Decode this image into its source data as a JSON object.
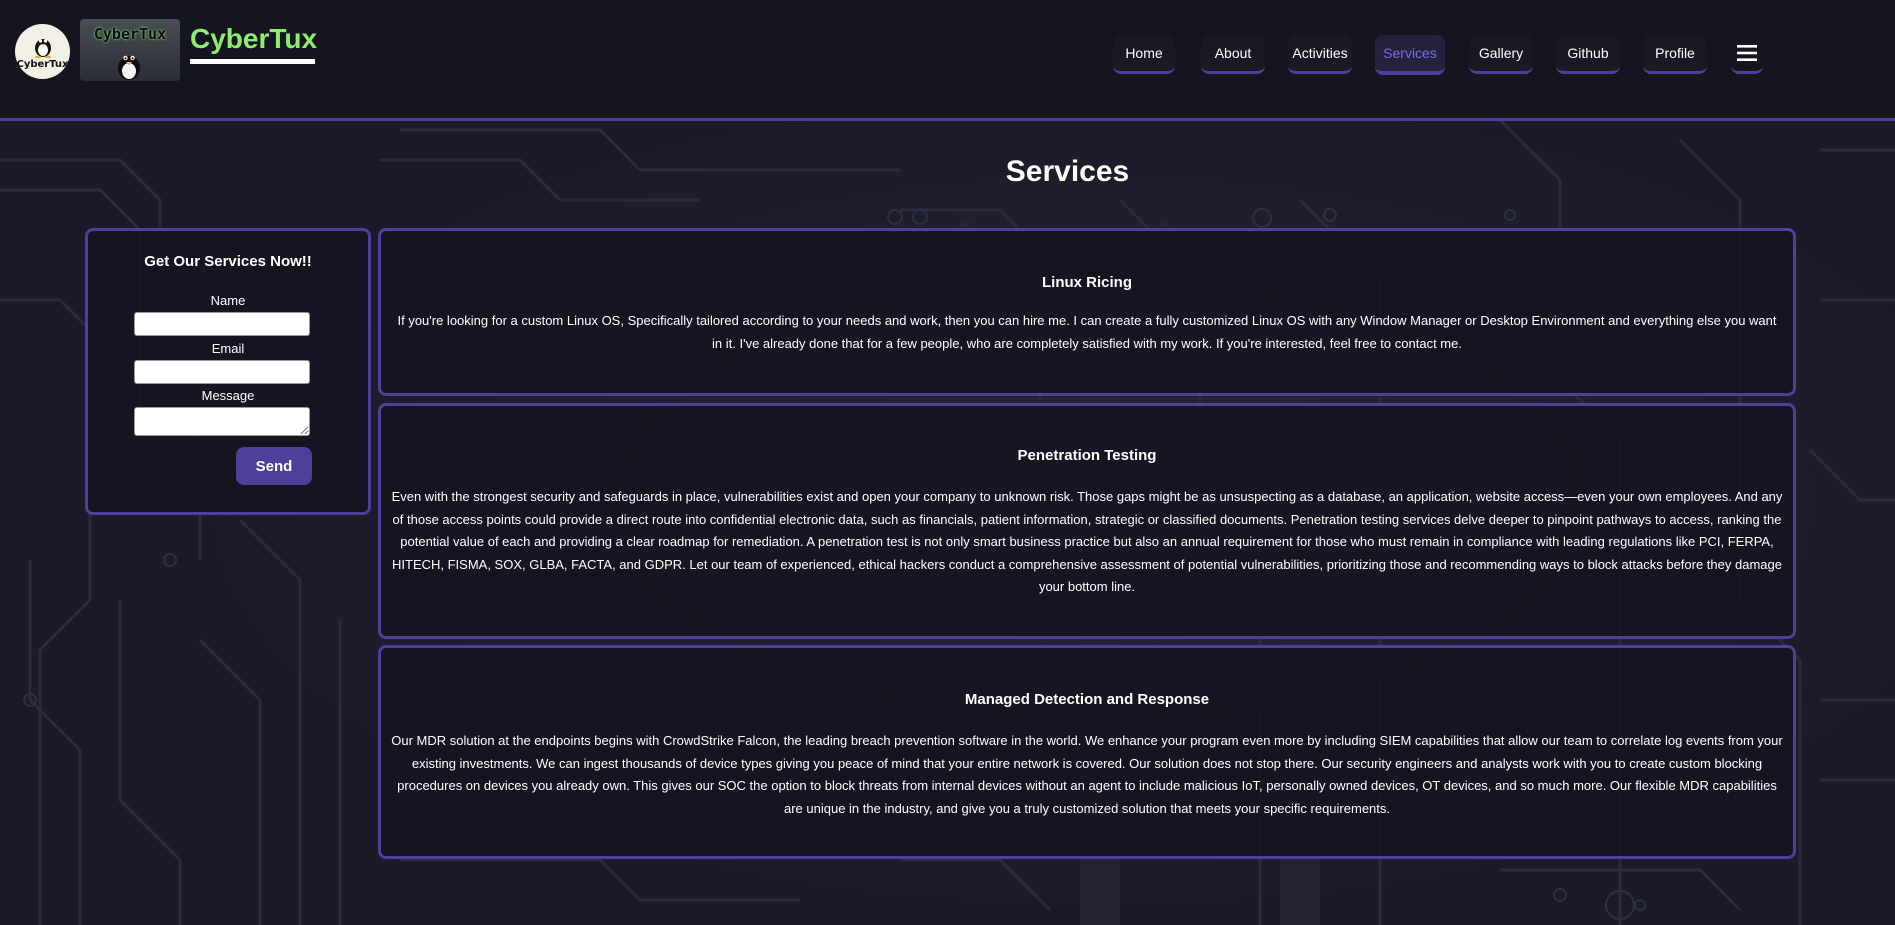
{
  "header": {
    "logo_circle_text": "CyberTux",
    "logo_banner_text": "CyberTux",
    "brand": "CyberTux"
  },
  "nav": {
    "items": [
      {
        "label": "Home"
      },
      {
        "label": "About"
      },
      {
        "label": "Activities"
      },
      {
        "label": "Services",
        "active": true
      },
      {
        "label": "Gallery"
      },
      {
        "label": "Github"
      },
      {
        "label": "Profile"
      }
    ],
    "menu_icon": "hamburger-menu-icon"
  },
  "page": {
    "title": "Services"
  },
  "form": {
    "title": "Get Our Services Now!!",
    "name_label": "Name",
    "email_label": "Email",
    "message_label": "Message",
    "name_value": "",
    "email_value": "",
    "message_value": "",
    "send_label": "Send"
  },
  "services": [
    {
      "title": "Linux Ricing",
      "text": "If you're looking for a custom Linux OS, Specifically tailored according to your needs and work, then you can hire me. I can create a fully customized Linux OS with any Window Manager or Desktop Environment and everything else you want in it. I've already done that for a few people, who are completely satisfied with my work. If you're interested, feel free to contact me."
    },
    {
      "title": "Penetration Testing",
      "text": "Even with the strongest security and safeguards in place, vulnerabilities exist and open your company to unknown risk. Those gaps might be as unsuspecting as a database, an application, website access—even your own employees. And any of those access points could provide a direct route into confidential electronic data, such as financials, patient information, strategic or classified documents. Penetration testing services delve deeper to pinpoint pathways to access, ranking the potential value of each and providing a clear roadmap for remediation. A penetration test is not only smart business practice but also an annual requirement for those who must remain in compliance with leading regulations like PCI, FERPA, HITECH, FISMA, SOX, GLBA, FACTA, and GDPR. Let our team of experienced, ethical hackers conduct a comprehensive assessment of potential vulnerabilities, prioritizing those and recommending ways to block attacks before they damage your bottom line."
    },
    {
      "title": "Managed Detection and Response",
      "text": "Our MDR solution at the endpoints begins with CrowdStrike Falcon, the leading breach prevention software in the world. We enhance your program even more by including SIEM capabilities that allow our team to correlate log events from your existing investments. We can ingest thousands of device types giving you peace of mind that your entire network is covered. Our solution does not stop there. Our security engineers and analysts work with you to create custom blocking procedures on devices you already own. This gives our SOC the option to block threats from internal devices without an agent to include malicious IoT, personally owned devices, OT devices, and so much more. Our flexible MDR capabilities are unique in the industry, and give you a truly customized solution that meets your specific requirements."
    }
  ],
  "colors": {
    "accent": "#4e3f9a",
    "brand_green": "#8bef6d",
    "active_nav": "#7b6fe0",
    "background": "#1a1a28"
  }
}
